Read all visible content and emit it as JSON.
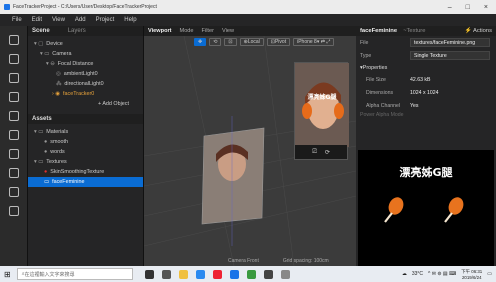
{
  "window": {
    "title": "FaceTrackerProject - C:/Users/User/Desktop/FaceTrackerProject"
  },
  "menu": [
    "File",
    "Edit",
    "View",
    "Add",
    "Project",
    "Help"
  ],
  "scene_panel": {
    "tabs": [
      "Scene",
      "Layers"
    ],
    "tree": [
      {
        "label": "Device",
        "depth": 0
      },
      {
        "label": "Camera",
        "depth": 1
      },
      {
        "label": "Focal Distance",
        "depth": 2
      },
      {
        "label": "ambientLight0",
        "depth": 3
      },
      {
        "label": "directionalLight0",
        "depth": 3
      },
      {
        "label": "faceTracker0",
        "depth": 3
      }
    ],
    "add_object": "+ Add Object"
  },
  "assets_panel": {
    "title": "Assets",
    "tree": [
      {
        "label": "Materials",
        "depth": 0
      },
      {
        "label": "smooth",
        "depth": 1
      },
      {
        "label": "words",
        "depth": 1
      },
      {
        "label": "Textures",
        "depth": 0
      },
      {
        "label": "SkinSmoothingTexture",
        "depth": 1
      },
      {
        "label": "faceFeminine",
        "depth": 1
      }
    ],
    "selected": "faceFeminine"
  },
  "viewport": {
    "tabs": [
      "Viewport",
      "Mode",
      "Filter",
      "View"
    ],
    "tools": [
      "Local",
      "Pivot",
      "iPhone 8"
    ],
    "footer_camera": "Camera Front",
    "footer_grid": "Grid spacing: 100cm"
  },
  "properties": {
    "title": "faceFeminine",
    "subtitle": "~Texture",
    "actions": "Actions",
    "file_label": "File",
    "file_value": "textures/faceFeminine.png",
    "type_label": "Type",
    "type_value": "Single Texture",
    "section": "Properties",
    "rows": [
      {
        "k": "File Size",
        "v": "42.63 kB"
      },
      {
        "k": "Dimensions",
        "v": "1024 x 1024"
      },
      {
        "k": "Alpha Channel",
        "v": "Yes"
      }
    ],
    "cut_off": "Power Alpha Mode"
  },
  "preview": {
    "caption": "漂亮姊G腿"
  },
  "taskbar": {
    "search_placeholder": "在這裡輸入文字來搜尋",
    "temp": "33°C",
    "time": "下午 06:31",
    "date": "2019/6/24"
  },
  "colors": {
    "accent": "#0a6cd3",
    "orange": "#e8a33b"
  }
}
